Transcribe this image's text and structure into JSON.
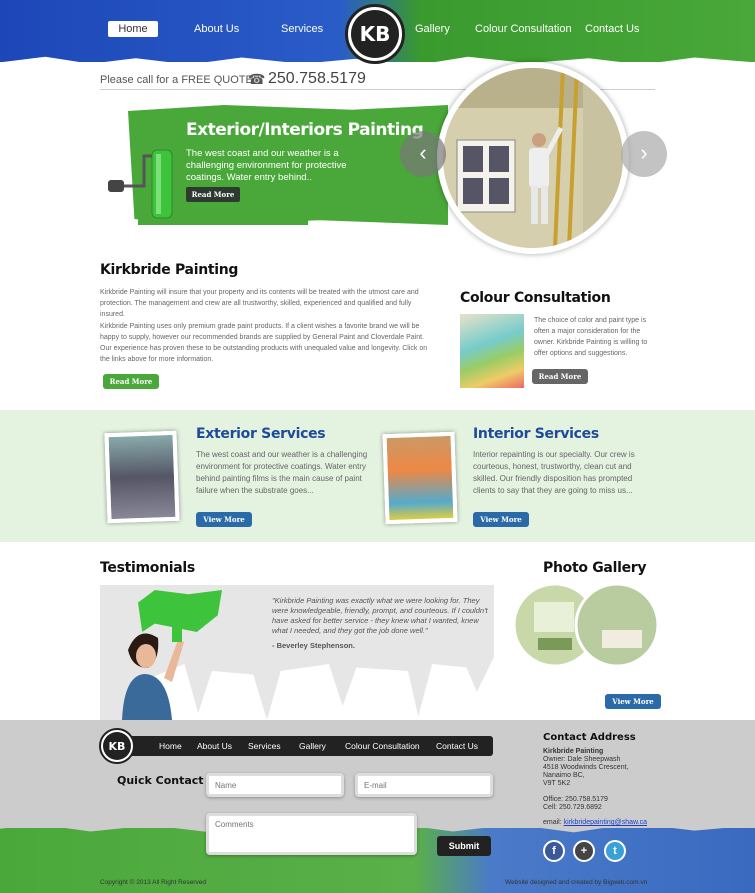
{
  "header": {
    "nav": [
      "Home",
      "About Us",
      "Services",
      "Gallery",
      "Colour Consultation",
      "Contact Us"
    ],
    "logo_text": "KB",
    "call_label": "Please call for a FREE QUOTE",
    "phone": "250.758.5179",
    "colors": {
      "blue": "#1d47b8",
      "green": "#4aa83a"
    }
  },
  "hero": {
    "title": "Exterior/Interiors Painting",
    "text": "The west coast and our weather is a challenging environment for protective coatings. Water entry behind..",
    "button": "Read More",
    "prev_arrow": "‹",
    "next_arrow": "›"
  },
  "intro": {
    "title": "Kirkbride Painting",
    "p1": "Kirkbride Painting will insure that your property and its contents will be treated with the utmost care and protection. The management and crew are all trustworthy, skilled, experienced and qualified and fully insured.",
    "p2": "Kirkbride Painting uses only premium grade paint products. If a client wishes a favorite brand we will be happy to supply, however our recommended brands are supplied by General Paint and Cloverdale Paint. Our experience has proven these to be outstanding products with unequaled value and longevity. Click on the links above for more information.",
    "button": "Read More"
  },
  "colour": {
    "title": "Colour Consultation",
    "text": "The choice of color and paint type is often a major consideration for the owner. Kirkbride Painting is willing to offer options and suggestions.",
    "button": "Read More"
  },
  "services": {
    "exterior": {
      "title": "Exterior Services",
      "text": "The west coast and our weather is a challenging environment for protective coatings. Water entry behind painting films is the main cause of paint failure when the substrate goes...",
      "button": "View More"
    },
    "interior": {
      "title": "Interior Services",
      "text": "Interior repainting is our specialty. Our crew is courteous, honest, trustworthy, clean cut and skilled. Our friendly disposition has prompted clients to say that they are going to miss us...",
      "button": "View More"
    }
  },
  "testimonials": {
    "title": "Testimonials",
    "quote": "\"Kirkbride Painting was exactly what we were looking for. They were knowledgeable, friendly, prompt, and courteous. If I couldn't have asked for better service - they knew what I wanted, knew what I needed, and they got the job done well.\"",
    "author": "- Beverley Stephenson."
  },
  "gallery": {
    "title": "Photo Gallery",
    "button": "View More"
  },
  "footer": {
    "logo_text": "KB",
    "nav": [
      "Home",
      "About Us",
      "Services",
      "Gallery",
      "Colour Consultation",
      "Contact Us"
    ],
    "quick_contact": "Quick Contact",
    "name_placeholder": "Name",
    "email_placeholder": "E-mail",
    "comments_placeholder": "Comments",
    "submit": "Submit",
    "address_title": "Contact Address",
    "company": "Kirkbride Painting",
    "address_lines": [
      "Owner: Dale Sheepwash",
      "4518 Woodwinds Crescent,",
      "Nanaimo BC,",
      "V9T 5K2"
    ],
    "office": "Office: 250.758.5179",
    "cell": "Cell: 250.729.6892",
    "email_label": "email:",
    "email": "kirkbridepainting@shaw.ca",
    "social": [
      "f",
      "+",
      "t"
    ],
    "copyright": "Copyright © 2013 All Right Reserved",
    "designed_by": "Website designed and created by Bigweb.com.vn"
  }
}
